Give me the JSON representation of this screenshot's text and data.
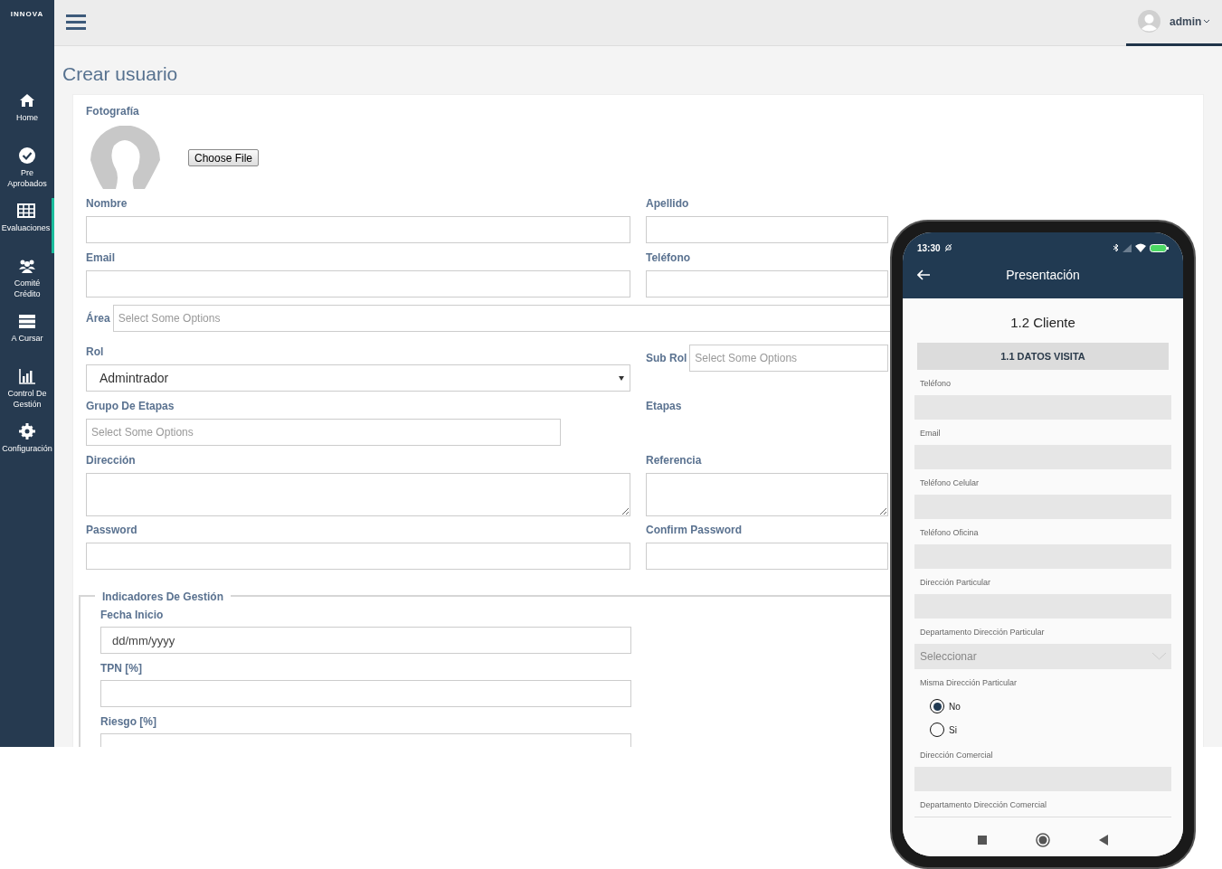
{
  "sidebar": {
    "logo": "INNOVA",
    "items": [
      {
        "label": "Home",
        "selected": false
      },
      {
        "label": "Pre Aprobados",
        "selected": false
      },
      {
        "label": "Evaluaciones",
        "selected": true
      },
      {
        "label": "Comité Crédito",
        "selected": false
      },
      {
        "label": "A Cursar",
        "selected": false
      },
      {
        "label": "Control De Gestión",
        "selected": false
      },
      {
        "label": "Configuración",
        "selected": false
      }
    ]
  },
  "topbar": {
    "user": "admin"
  },
  "page_title": "Crear usuario",
  "photo": {
    "label": "Fotografía",
    "button": "Choose File"
  },
  "form_rows": [
    [
      {
        "label": "Nombre",
        "kind": "text"
      },
      {
        "label": "Apellido",
        "kind": "text"
      }
    ],
    [
      {
        "label": "Email",
        "kind": "text"
      },
      {
        "label": "Teléfono",
        "kind": "text"
      }
    ],
    [
      {
        "label": "Área",
        "kind": "inline_multi",
        "placeholder": "Select Some Options"
      }
    ],
    [
      {
        "label": "Rol",
        "kind": "select",
        "value": "Admintrador"
      },
      {
        "label": "Sub Rol",
        "kind": "inline_multi",
        "placeholder": "Select Some Options"
      }
    ],
    [
      {
        "label": "Grupo De Etapas",
        "kind": "multi",
        "placeholder": "Select Some Options"
      },
      {
        "label": "Etapas",
        "kind": "label"
      }
    ],
    [
      {
        "label": "Dirección",
        "kind": "textarea"
      },
      {
        "label": "Referencia",
        "kind": "textarea"
      }
    ],
    [
      {
        "label": "Password",
        "kind": "text"
      },
      {
        "label": "Confirm Password",
        "kind": "text"
      }
    ]
  ],
  "indicadores": {
    "legend": "Indicadores De Gestión",
    "fields": [
      {
        "label": "Fecha Inicio",
        "placeholder": "dd/mm/yyyy"
      },
      {
        "label": "TPN [%]"
      },
      {
        "label": "Riesgo [%]"
      }
    ]
  },
  "phone": {
    "time": "13:30",
    "title": "Presentación",
    "section": "1.2 Cliente",
    "tab": "1.1 DATOS VISITA",
    "fields": [
      {
        "label": "Teléfono",
        "kind": "text"
      },
      {
        "label": "Email",
        "kind": "text"
      },
      {
        "label": "Teléfono Celular",
        "kind": "text"
      },
      {
        "label": "Teléfono Oficina",
        "kind": "text"
      },
      {
        "label": "Dirección Particular",
        "kind": "text"
      },
      {
        "label": "Departamento Dirección Particular",
        "kind": "select",
        "placeholder": "Seleccionar"
      },
      {
        "label": "Misma Dirección Particular",
        "kind": "radio",
        "options": [
          {
            "label": "No",
            "selected": true
          },
          {
            "label": "Si",
            "selected": false
          }
        ]
      },
      {
        "label": "Dirección Comercial",
        "kind": "text"
      },
      {
        "label": "Departamento Dirección Comercial",
        "kind": "cut"
      }
    ]
  }
}
